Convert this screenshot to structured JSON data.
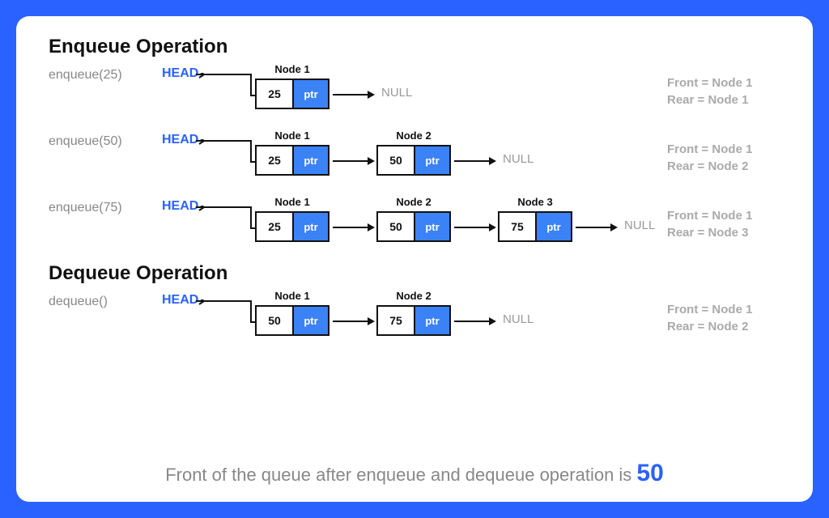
{
  "sections": {
    "enqueue_title": "Enqueue Operation",
    "dequeue_title": "Dequeue Operation"
  },
  "labels": {
    "head": "HEAD",
    "ptr": "ptr",
    "null": "NULL",
    "node_prefix": "Node"
  },
  "rows": [
    {
      "op": "enqueue(25)",
      "nodes": [
        {
          "label": "Node 1",
          "value": "25"
        }
      ],
      "front": "Front = Node 1",
      "rear": "Rear = Node 1"
    },
    {
      "op": "enqueue(50)",
      "nodes": [
        {
          "label": "Node 1",
          "value": "25"
        },
        {
          "label": "Node 2",
          "value": "50"
        }
      ],
      "front": "Front = Node 1",
      "rear": "Rear = Node 2"
    },
    {
      "op": "enqueue(75)",
      "nodes": [
        {
          "label": "Node 1",
          "value": "25"
        },
        {
          "label": "Node 2",
          "value": "50"
        },
        {
          "label": "Node 3",
          "value": "75"
        }
      ],
      "front": "Front = Node 1",
      "rear": "Rear = Node 3"
    },
    {
      "op": "dequeue()",
      "nodes": [
        {
          "label": "Node 1",
          "value": "50"
        },
        {
          "label": "Node 2",
          "value": "75"
        }
      ],
      "front": "Front = Node 1",
      "rear": "Rear = Node 2"
    }
  ],
  "summary": {
    "text": "Front of the queue after enqueue and dequeue operation is ",
    "value": "50"
  }
}
